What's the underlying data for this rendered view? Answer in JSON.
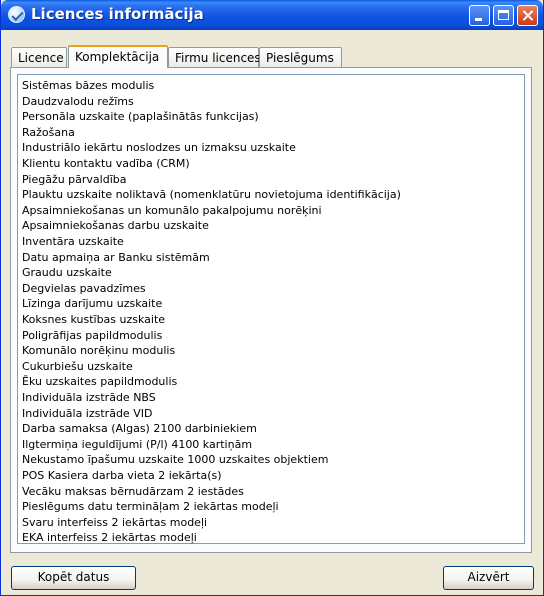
{
  "window": {
    "title": "Licences informācija"
  },
  "tabs": [
    {
      "label": "Licence"
    },
    {
      "label": "Komplektācija"
    },
    {
      "label": "Firmu licences"
    },
    {
      "label": "Pieslēgums"
    }
  ],
  "active_tab": "Komplektācija",
  "list": [
    "Sistēmas bāzes modulis",
    "Daudzvalodu režīms",
    "Personāla uzskaite (paplašinātās funkcijas)",
    "Ražošana",
    "Industriālo iekārtu noslodzes un izmaksu uzskaite",
    "Klientu kontaktu vadība (CRM)",
    "Piegāžu pārvaldība",
    "Plauktu uzskaite noliktavā (nomenklatūru novietojuma identifikācija)",
    "Apsaimniekošanas un komunālo pakalpojumu norēķini",
    "Apsaimniekošanas darbu uzskaite",
    "Inventāra uzskaite",
    "Datu apmaiņa ar Banku sistēmām",
    "Graudu uzskaite",
    "Degvielas pavadzīmes",
    "Līzinga darījumu uzskaite",
    "Koksnes kustības uzskaite",
    "Poligrāfijas papildmodulis",
    "Komunālo norēķinu modulis",
    "Cukurbiešu uzskaite",
    "Ēku uzskaites papildmodulis",
    "Individuāla izstrāde NBS",
    "Individuāla izstrāde VID",
    "Darba samaksa (Algas) 2100 darbiniekiem",
    "Ilgtermiņa ieguldījumi (P/l) 4100 kartiņām",
    "Nekustamo īpašumu uzskaite 1000 uzskaites objektiem",
    "POS Kasiera darba vieta 2 iekārta(s)",
    "Vecāku maksas bērnudārzam 2 iestādes",
    "Pieslēgums datu termināļam 2 iekārtas modeļi",
    "Svaru interfeiss 2 iekārtas modeļi",
    "EKA interfeiss 2 iekārtas modeļi"
  ],
  "buttons": {
    "copy": "Kopēt datus",
    "close": "Aizvērt"
  }
}
